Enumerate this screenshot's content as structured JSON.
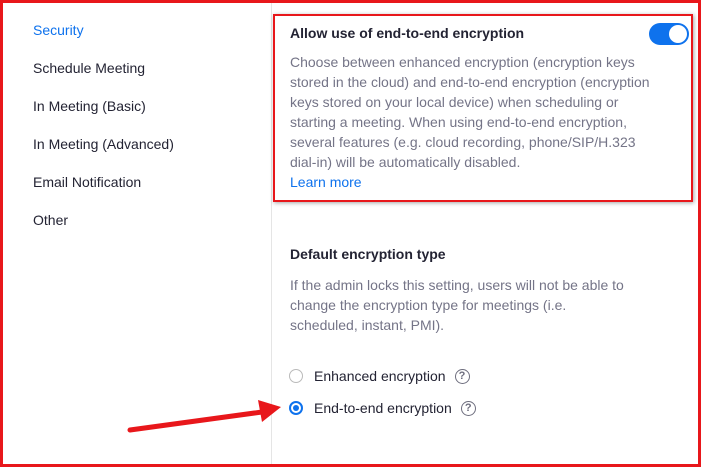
{
  "sidebar": {
    "items": [
      {
        "label": "Security",
        "active": true
      },
      {
        "label": "Schedule Meeting",
        "active": false
      },
      {
        "label": "In Meeting (Basic)",
        "active": false
      },
      {
        "label": "In Meeting (Advanced)",
        "active": false
      },
      {
        "label": "Email Notification",
        "active": false
      },
      {
        "label": "Other",
        "active": false
      }
    ]
  },
  "e2e_setting": {
    "title": "Allow use of end-to-end encryption",
    "toggle_on": true,
    "description": "Choose between enhanced encryption (encryption keys stored in the cloud) and end-to-end encryption (encryption keys stored on your local device) when scheduling or starting a meeting. When using end-to-end encryption, several features (e.g. cloud recording, phone/SIP/H.323 dial-in) will be automatically disabled.",
    "learn_more": "Learn more"
  },
  "encryption_type": {
    "title": "Default encryption type",
    "description": "If the admin locks this setting, users will not be able to change the encryption type for meetings (i.e. scheduled, instant, PMI).",
    "options": [
      {
        "label": "Enhanced encryption",
        "checked": false,
        "help": "?"
      },
      {
        "label": "End-to-end encryption",
        "checked": true,
        "help": "?"
      }
    ]
  },
  "colors": {
    "accent": "#0e72ed",
    "annotation_red": "#e8171b",
    "text": "#232333",
    "muted_text": "#747487"
  },
  "icons": {
    "toggle": "toggle-switch",
    "help": "question-circle-icon",
    "annotation": "red-arrow"
  }
}
